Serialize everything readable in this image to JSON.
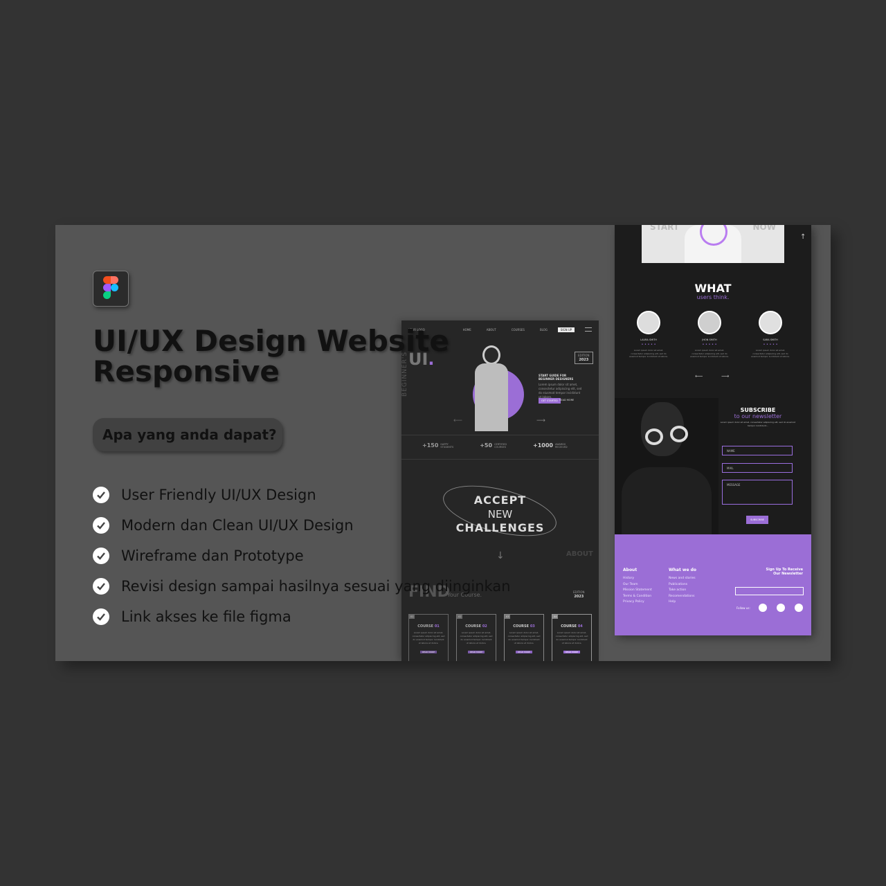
{
  "hero": {
    "title_line1": "UI/UX Design Website",
    "title_line2": "Responsive",
    "subtitle": "Apa yang anda dapat?"
  },
  "features": [
    "User Friendly UI/UX Design",
    "Modern dan Clean UI/UX Design",
    "Wireframe dan Prototype",
    "Revisi design sampai hasilnya sesuai yang diinginkan",
    "Link akses ke file figma"
  ],
  "colors": {
    "accent": "#9b6ed6",
    "page_bg": "#333333",
    "card_bg": "#555555"
  },
  "icons": {
    "logo": "figma-logo-icon",
    "bullet": "checkmark-circle-icon"
  },
  "mockup_desktop": {
    "logo": "YOUR LOGO",
    "nav": [
      "HOME",
      "ABOUT",
      "COURSES",
      "BLOG"
    ],
    "nav_button": "SIGN UP",
    "big_ui": "UI",
    "side_text": "BEGINNER'S",
    "edition_label": "EDITION",
    "edition_year": "2023",
    "hero_title": "START GUIDE FOR BEGINNER DESIGNERS",
    "hero_body": "Lorem ipsum dolor sit amet, consectetur adipiscing elit, sed do eiusmod tempor incididunt ut labore.",
    "btn_primary": "GET STARTED",
    "btn_secondary": "READ MORE",
    "stats": [
      {
        "value": "+150",
        "label_1": "HAPPY",
        "label_2": "STUDENTS"
      },
      {
        "value": "+50",
        "label_1": "CERTIFIED",
        "label_2": "COURSES"
      },
      {
        "value": "+1000",
        "label_1": "AWARDS",
        "label_2": "RECEIVED"
      }
    ],
    "accept_1": "ACCEPT",
    "accept_2": "NEW",
    "accept_3": "CHALLENGES",
    "about_label": "ABOUT",
    "find_title": "FIND",
    "find_sub": "Your Course.",
    "courses": [
      {
        "num": "01",
        "name": "COURSE",
        "id": "01"
      },
      {
        "num": "02",
        "name": "COURSE",
        "id": "02"
      },
      {
        "num": "03",
        "name": "COURSE",
        "id": "03"
      },
      {
        "num": "04",
        "name": "COURSE",
        "id": "04"
      }
    ],
    "course_body": "Lorem ipsum dolor sit amet, consectetur adipiscing elit, sed do eiusmod tempor incididunt ut labore et dolore.",
    "course_btn": "READ MORE"
  },
  "mockup_mobile": {
    "start_left": "START",
    "start_right": "NOW",
    "what_title": "WHAT",
    "what_sub": "users think.",
    "testimonials": [
      {
        "name": "LAURA SMITH"
      },
      {
        "name": "JHON SMITH"
      },
      {
        "name": "SARA SMITH"
      }
    ],
    "testimonial_body": "Lorem ipsum dolor sit amet, consectetur adipiscing elit, sed do eiusmod tempor incididunt ut labore.",
    "subscribe_title": "SUBSCRIBE",
    "subscribe_sub": "to our newsletter",
    "subscribe_body": "Lorem ipsum dolor sit amet, consectetur adipiscing elit, sed do eiusmod tempor incididunt...",
    "field_name": "NAME",
    "field_mail": "MAIL",
    "field_message": "MESSAGE",
    "subscribe_btn": "SUBSCRIBE",
    "footer": {
      "about_title": "About",
      "about_items": [
        "History",
        "Our Team",
        "Mission Statement",
        "Terms & Condition",
        "Privacy Policy"
      ],
      "what_title": "What we do",
      "what_items": [
        "News and stories",
        "Publications",
        "Take action",
        "Recomendations",
        "Help"
      ],
      "signup_1": "Sign Up To Receive",
      "signup_2": "Our Newsletter",
      "follow": "Follow us:"
    }
  }
}
